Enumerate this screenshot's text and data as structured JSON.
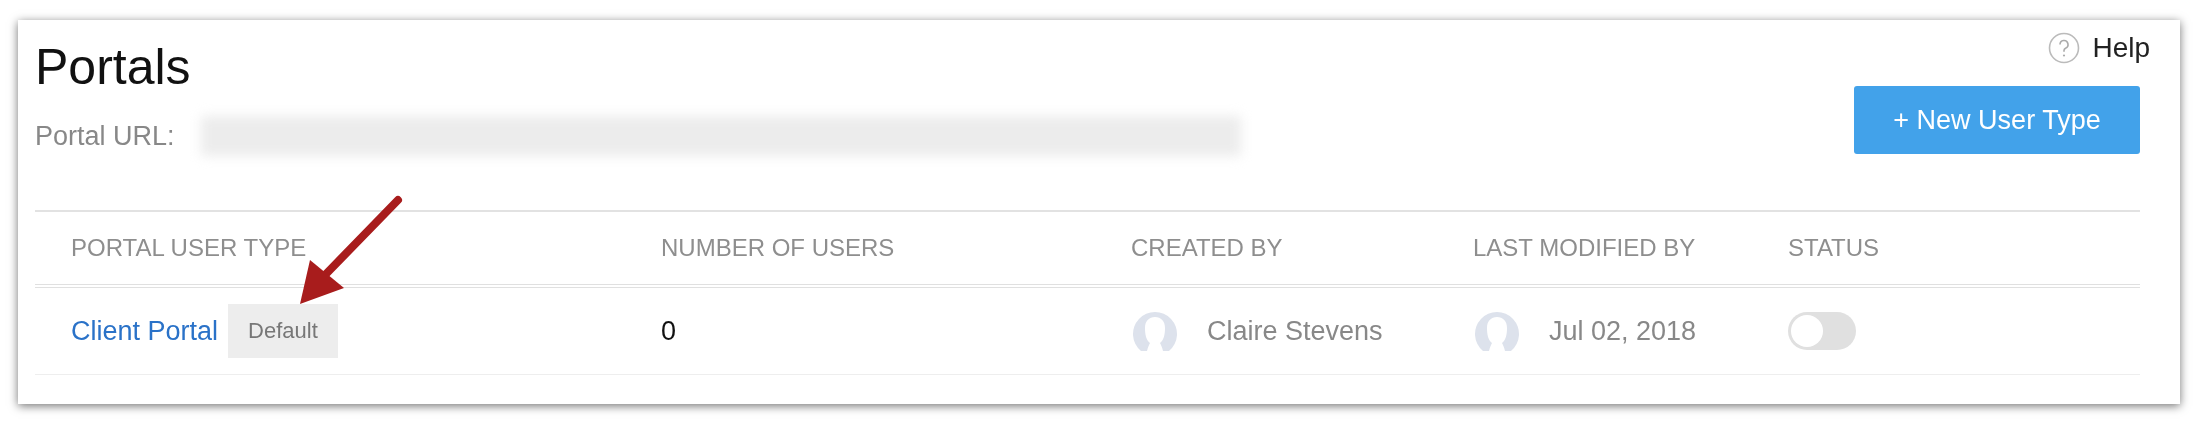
{
  "title": "Portals",
  "help": {
    "label": "Help"
  },
  "portal_url": {
    "label": "Portal URL:"
  },
  "new_button": {
    "label": "+ New User Type"
  },
  "table": {
    "columns": [
      "PORTAL USER TYPE",
      "NUMBER OF USERS",
      "CREATED BY",
      "LAST MODIFIED BY",
      "STATUS"
    ],
    "rows": [
      {
        "name": "Client Portal",
        "badge": "Default",
        "users": "0",
        "created_by": "Claire Stevens",
        "modified": "Jul 02, 2018",
        "on": false
      }
    ]
  }
}
